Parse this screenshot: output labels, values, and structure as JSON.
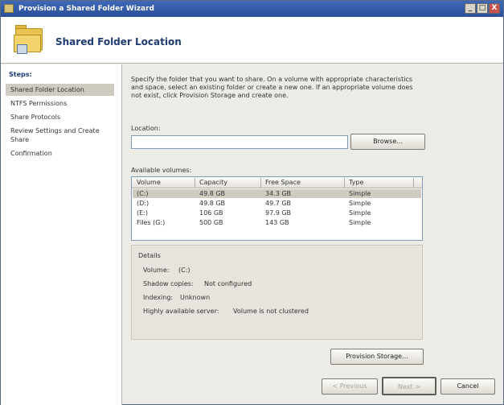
{
  "window": {
    "title": "Provision a Shared Folder Wizard",
    "minimize_glyph": "_",
    "maximize_glyph": "□",
    "close_glyph": "X"
  },
  "header": {
    "icon": "shared-folder-icon",
    "title": "Shared Folder Location"
  },
  "steps": {
    "title": "Steps:",
    "items": [
      {
        "label": "Shared Folder Location",
        "active": true
      },
      {
        "label": "NTFS Permissions",
        "active": false
      },
      {
        "label": "Share Protocols",
        "active": false
      },
      {
        "label": "Review Settings and Create Share",
        "active": false
      },
      {
        "label": "Confirmation",
        "active": false
      }
    ]
  },
  "main": {
    "intro": "Specify the folder that you want to share. On a volume with appropriate characteristics and space, select an existing folder or create a new one. If an appropriate volume does not exist, click Provision Storage and create one.",
    "location_label": "Location:",
    "location_value": "",
    "browse_label": "Browse...",
    "volumes_label": "Available volumes:",
    "columns": [
      "Volume",
      "Capacity",
      "Free Space",
      "Type"
    ],
    "rows": [
      {
        "volume": "(C:)",
        "capacity": "49.8 GB",
        "free": "34.3 GB",
        "type": "Simple",
        "selected": true
      },
      {
        "volume": "(D:)",
        "capacity": "49.8 GB",
        "free": "49.7 GB",
        "type": "Simple",
        "selected": false
      },
      {
        "volume": "(E:)",
        "capacity": "106 GB",
        "free": "97.9 GB",
        "type": "Simple",
        "selected": false
      },
      {
        "volume": "Files (G:)",
        "capacity": "500 GB",
        "free": "143 GB",
        "type": "Simple",
        "selected": false
      }
    ],
    "details": {
      "title": "Details",
      "rows": [
        {
          "label": "Volume:",
          "value": "(C:)"
        },
        {
          "label": "Shadow copies:",
          "value": "Not configured"
        },
        {
          "label": "Indexing:",
          "value": "Unknown"
        },
        {
          "label": "Highly available server:",
          "value": "Volume is not clustered"
        }
      ]
    },
    "provision_label": "Provision Storage..."
  },
  "footer": {
    "previous_label": "< Previous",
    "next_label": "Next >",
    "cancel_label": "Cancel"
  }
}
